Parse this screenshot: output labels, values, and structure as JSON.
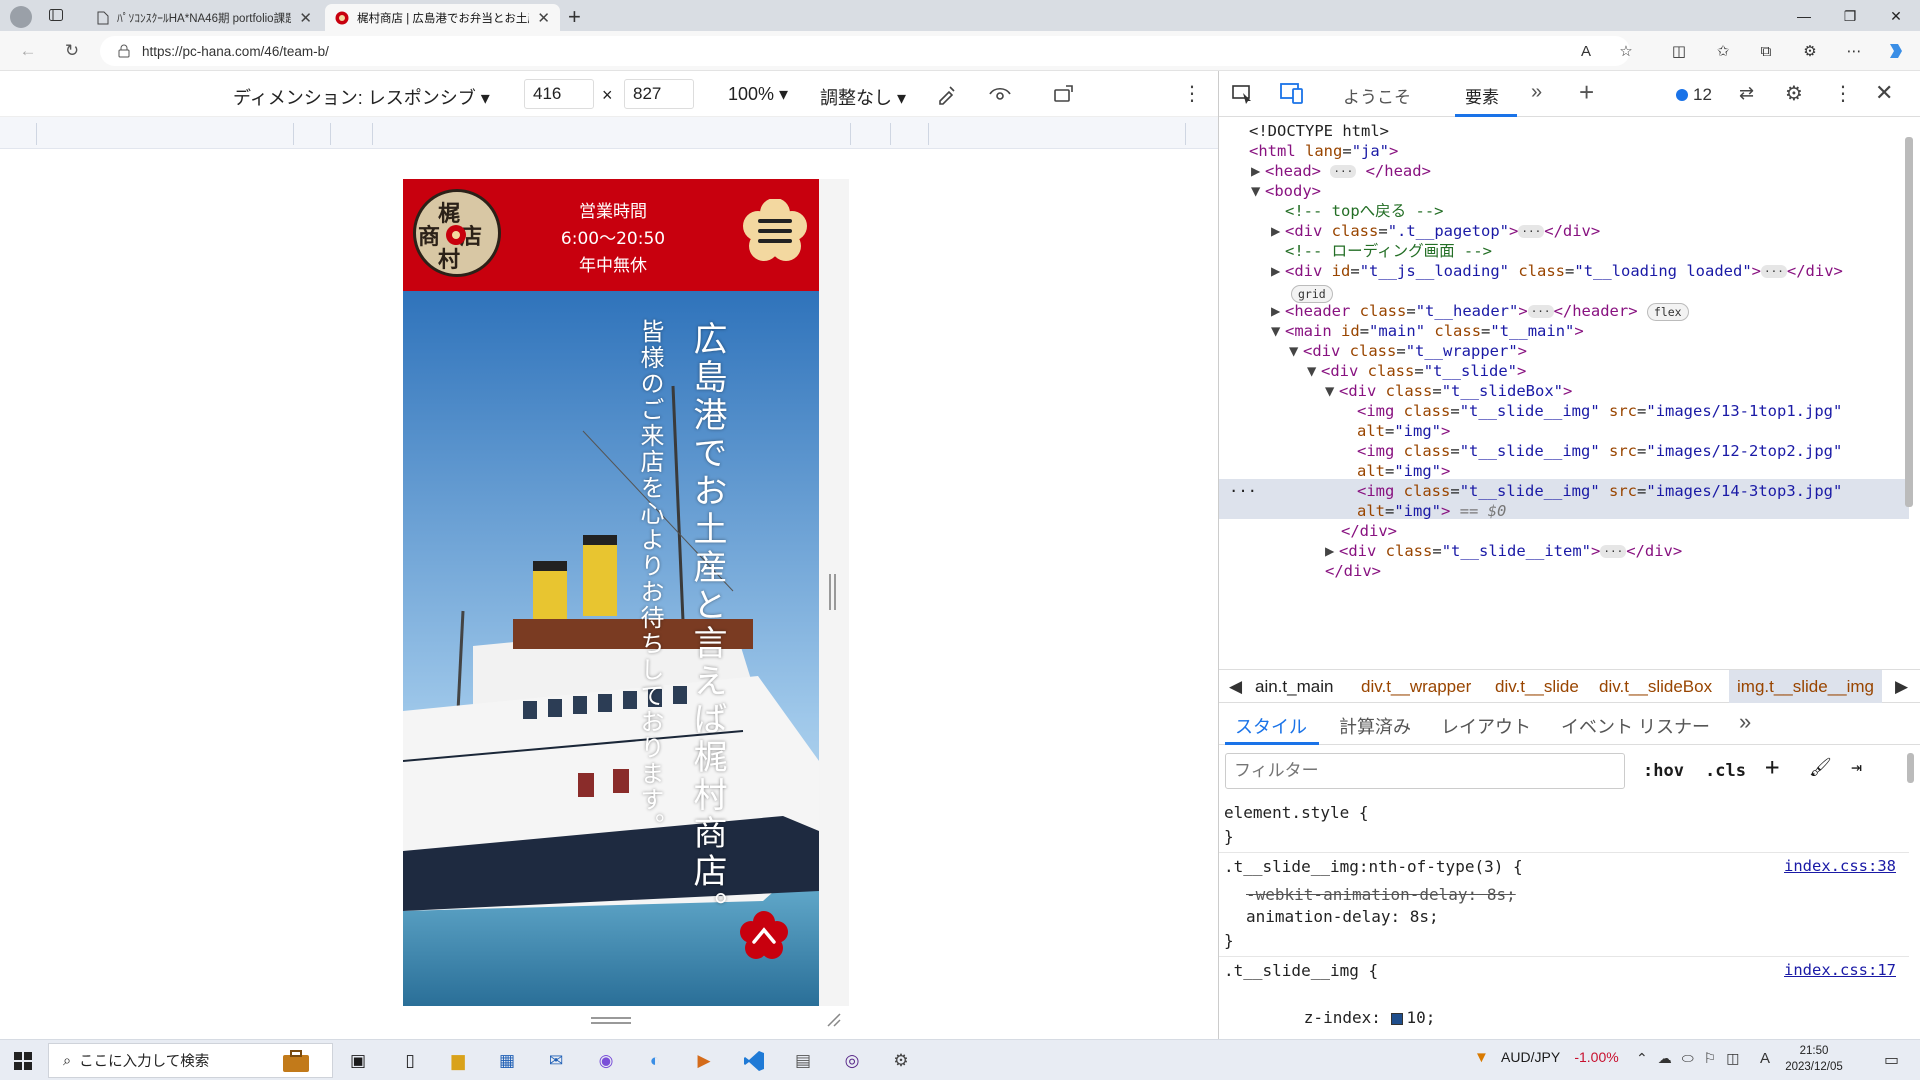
{
  "browser": {
    "tabs": [
      {
        "title": "ﾊﾟｿｺﾝｽｸｰﾙHA*NA46期 portfolio課題",
        "active": false
      },
      {
        "title": "梶村商店 | 広島港でお弁当とお土産",
        "active": true
      }
    ],
    "url": "https://pc-hana.com/46/team-b/"
  },
  "device_toolbar": {
    "dimension_label": "ディメンション: レスポンシブ",
    "width": "416",
    "times": "×",
    "height": "827",
    "zoom": "100%",
    "throttle": "調整なし"
  },
  "site": {
    "logo_chars": [
      "梶",
      "村",
      "商",
      "店"
    ],
    "hours_title": "営業時間",
    "hours_time": "6:00〜20:50",
    "hours_note": "年中無休",
    "hero_line1": "広島港でお土産と言えば梶村商店。",
    "hero_line2": "皆様のご来店を心よりお待ちしております。",
    "colors": {
      "brand_red": "#c8000e",
      "menu_bg": "#f3d8a0",
      "sky_top": "#3b7fc0"
    }
  },
  "devtools": {
    "tabs": {
      "welcome": "ようこそ",
      "elements": "要素",
      "issues_count": "12"
    },
    "dom": {
      "doctype": "<!DOCTYPE html>",
      "html_tag": "html",
      "html_lang_attr": "lang",
      "html_lang_val": "\"ja\"",
      "head": "head",
      "body": "body",
      "comment_top": "<!-- topへ戻る -->",
      "pagetop_class": "\".t__pagetop\"",
      "comment_loading": "<!-- ローディング画面 -->",
      "loading_id": "\"t__js__loading\"",
      "loading_class": "\"t__loading loaded\"",
      "grid_badge": "grid",
      "header_class": "\"t__header\"",
      "flex_badge": "flex",
      "main_id": "\"main\"",
      "main_class": "\"t__main\"",
      "wrapper_class": "\"t__wrapper\"",
      "slide_class": "\"t__slide\"",
      "slidebox_class": "\"t__slideBox\"",
      "img_class": "\"t__slide__img\"",
      "img1_src": "\"images/13-1top1.jpg\"",
      "img2_src": "\"images/12-2top2.jpg\"",
      "img3_src": "\"images/14-3top3.jpg\"",
      "alt_val": "\"img\"",
      "selected_marker": "== $0",
      "slide_item_class": "\"t__slide__item\""
    },
    "breadcrumbs": [
      "ain.t_main",
      "div.t__wrapper",
      "div.t__slide",
      "div.t__slideBox",
      "img.t__slide__img"
    ],
    "style_tabs": [
      "スタイル",
      "計算済み",
      "レイアウト",
      "イベント リスナー"
    ],
    "filter_placeholder": "フィルター",
    "hov": ":hov",
    "cls": ".cls",
    "rules": {
      "element_style": "element.style {",
      "close": "}",
      "rule1_selector": ".t__slide__img:nth-of-type(3) {",
      "rule1_src": "index.css:38",
      "rule1_prop_struck": "-webkit-animation-delay: 8s;",
      "rule1_prop": "animation-delay: 8s;",
      "rule2_selector": ".t__slide__img {",
      "rule2_src": "index.css:17",
      "rule2_prop": "z-index: ",
      "rule2_val": "10;"
    }
  },
  "taskbar": {
    "search_placeholder": "ここに入力して検索",
    "ticker": "AUD/JPY",
    "ticker_change": "-1.00%",
    "time": "21:50",
    "date": "2023/12/05",
    "ime": "A"
  }
}
